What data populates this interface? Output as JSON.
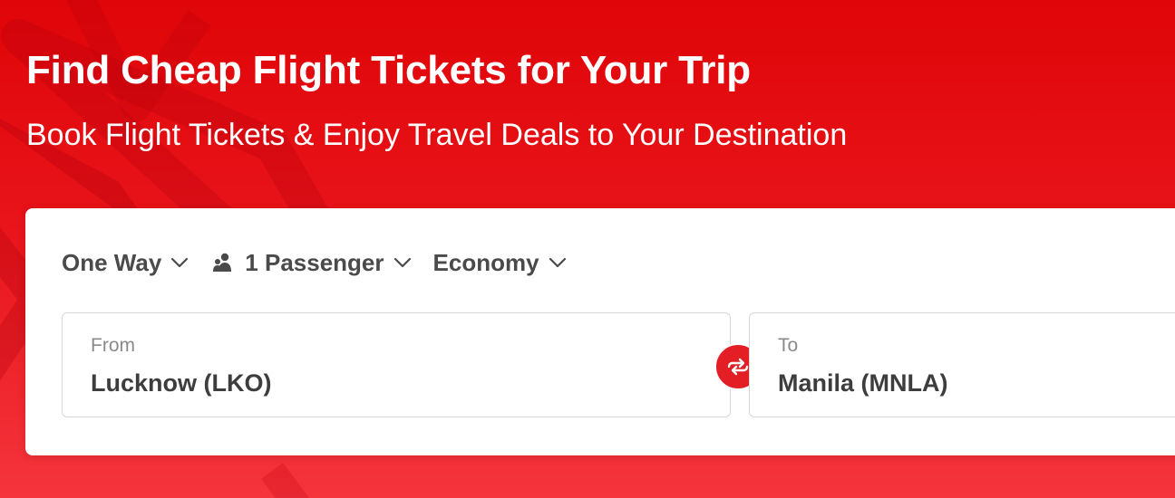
{
  "hero": {
    "title": "Find Cheap Flight Tickets for Your Trip",
    "subtitle": "Book Flight Tickets & Enjoy Travel Deals to Your Destination"
  },
  "search": {
    "trip_type": "One Way",
    "passengers": "1 Passenger",
    "cabin_class": "Economy",
    "from": {
      "label": "From",
      "value": "Lucknow (LKO)"
    },
    "to": {
      "label": "To",
      "value": "Manila (MNLA)"
    }
  },
  "icons": {
    "passenger": "users-icon",
    "dropdown": "chevron-down-icon",
    "swap": "swap-arrows-icon"
  },
  "colors": {
    "brand_red": "#e31e24",
    "hero_top": "#df0508",
    "hero_bottom": "#f5343c",
    "text_dark": "#4a4a4a",
    "label_gray": "#8a8a8a"
  }
}
